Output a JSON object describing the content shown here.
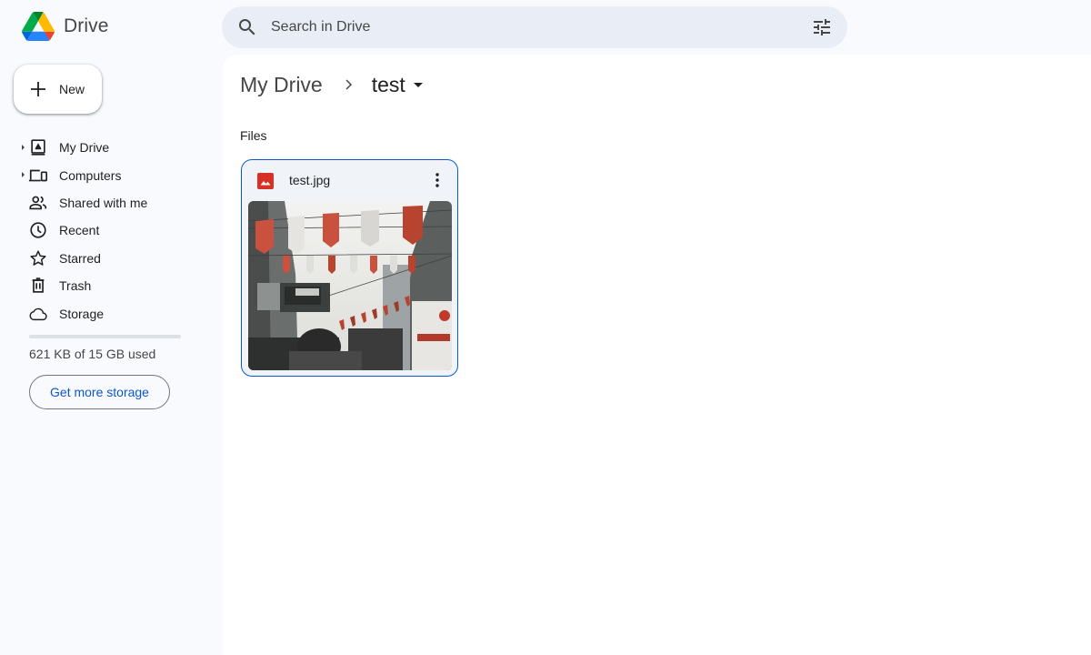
{
  "app": {
    "name": "Drive",
    "logo_colors": {
      "green": "#1ea362",
      "yellow": "#ffba00",
      "blue": "#4285f4",
      "darkblue": "#2684fc",
      "red": "#ea4335",
      "darkgreen": "#00832d"
    }
  },
  "search": {
    "placeholder": "Search in Drive",
    "value": "",
    "icon": "search-icon",
    "filter_icon": "tune-icon"
  },
  "sidebar": {
    "new_button": {
      "label": "New",
      "icon": "plus-icon"
    },
    "items": [
      {
        "label": "My Drive",
        "icon": "my-drive-icon",
        "expandable": true
      },
      {
        "label": "Computers",
        "icon": "computers-icon",
        "expandable": true
      },
      {
        "label": "Shared with me",
        "icon": "people-icon",
        "expandable": false
      },
      {
        "label": "Recent",
        "icon": "clock-icon",
        "expandable": false
      },
      {
        "label": "Starred",
        "icon": "star-icon",
        "expandable": false
      },
      {
        "label": "Trash",
        "icon": "trash-icon",
        "expandable": false
      },
      {
        "label": "Storage",
        "icon": "cloud-icon",
        "expandable": false
      }
    ],
    "storage": {
      "used_text": "621 KB of 15 GB used",
      "used_fraction": 4e-05,
      "button_label": "Get more storage"
    }
  },
  "main": {
    "breadcrumb": {
      "root": "My Drive",
      "current": "test"
    },
    "section_title": "Files",
    "files": [
      {
        "name": "test.jpg",
        "type": "image",
        "type_color": "#d93025",
        "selected": true
      }
    ]
  },
  "colors": {
    "accent": "#0b57d0",
    "background": "#f8fafd",
    "search_bg": "#e9eef6",
    "card_bg": "#f0f4f9"
  }
}
